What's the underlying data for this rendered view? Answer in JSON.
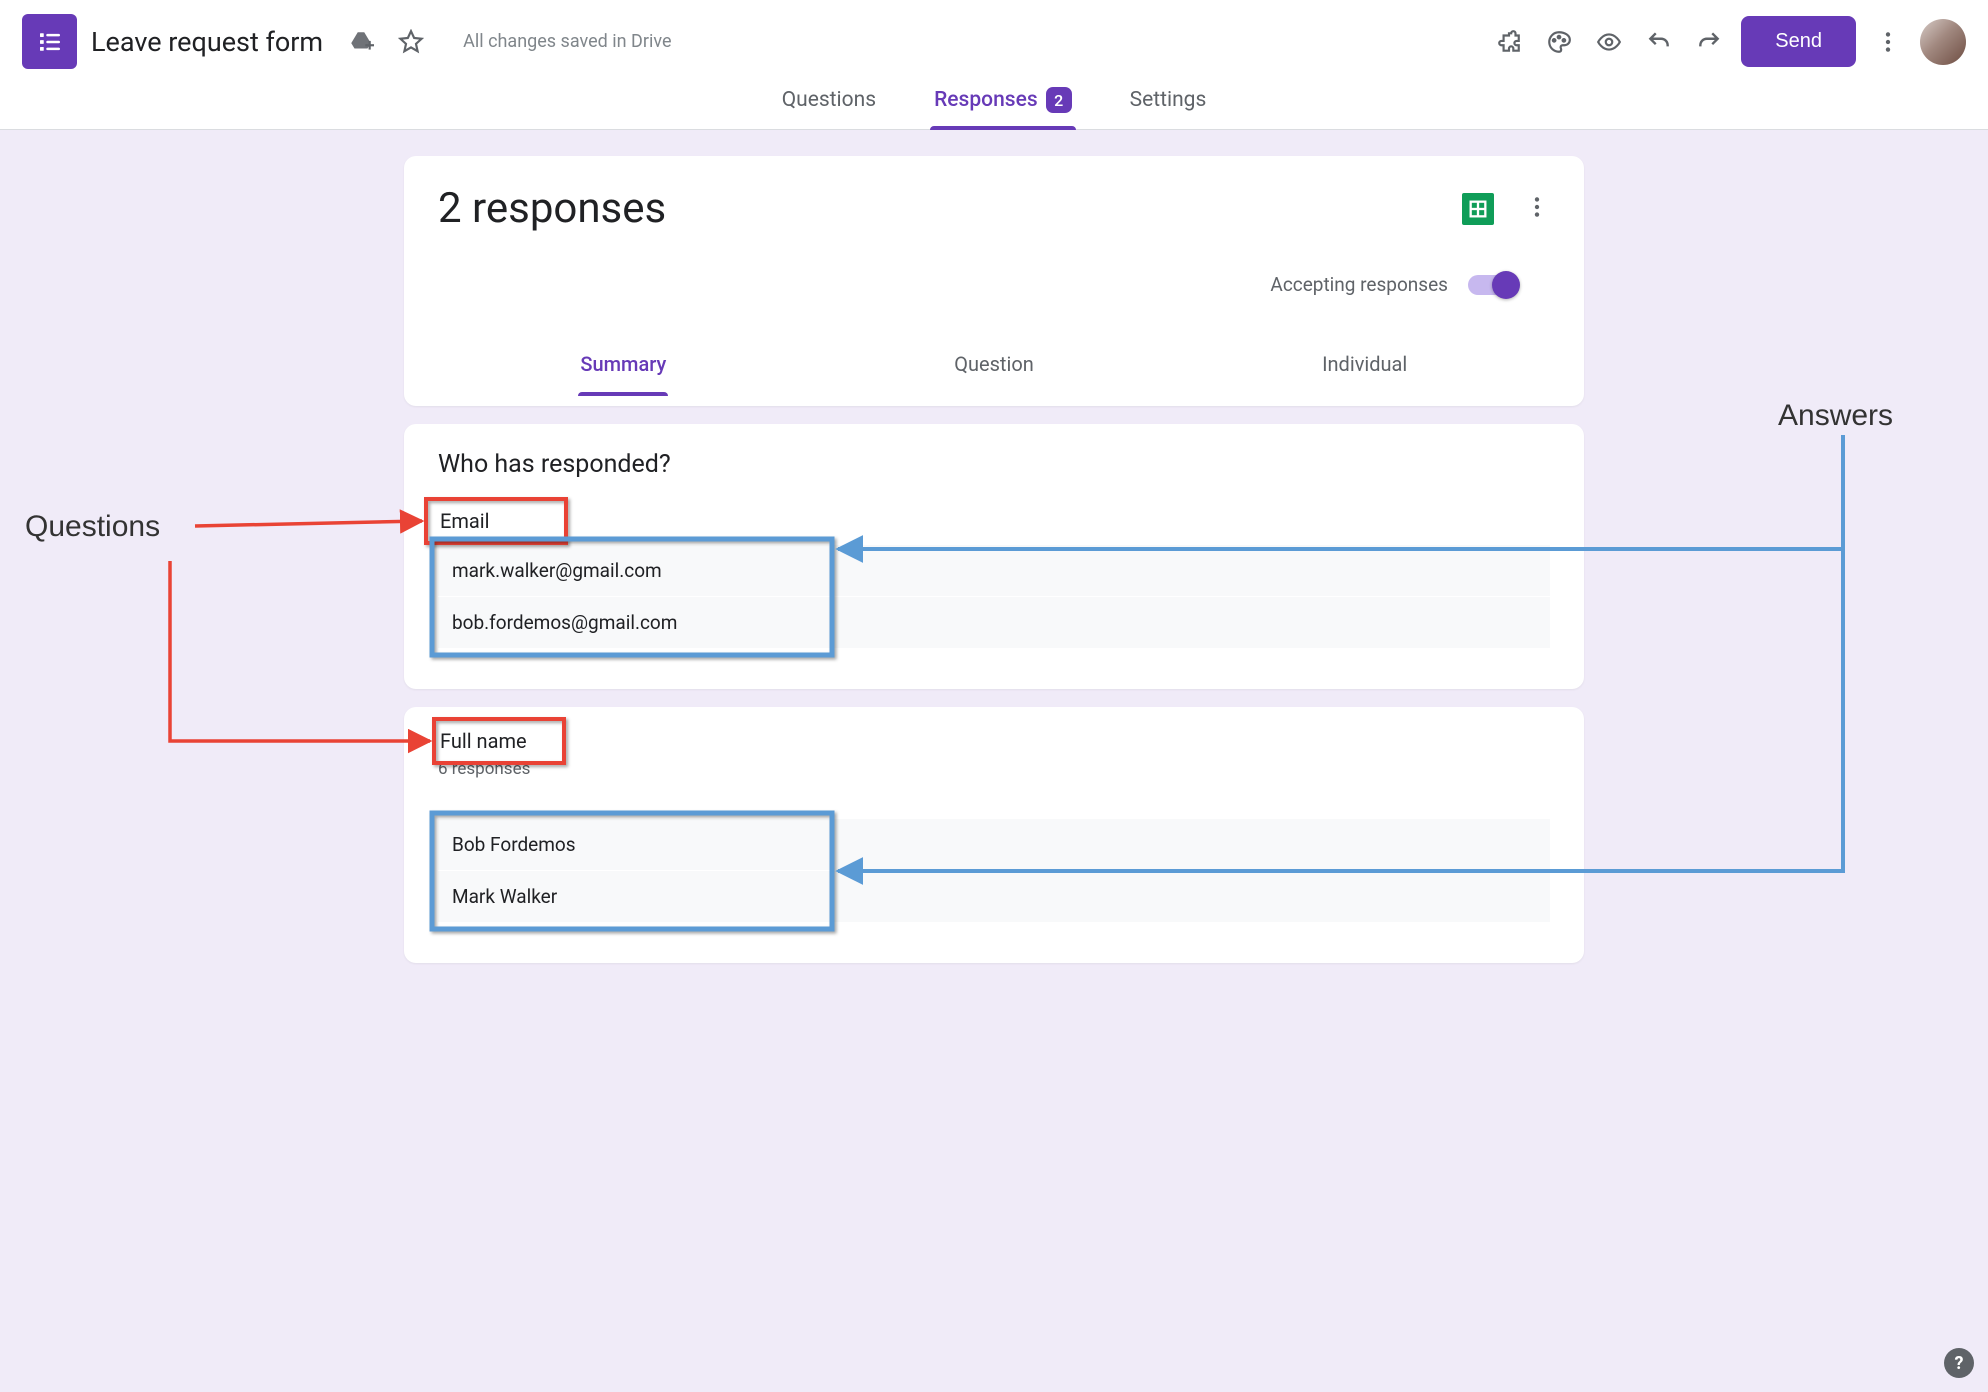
{
  "header": {
    "doc_title": "Leave request form",
    "save_status": "All changes saved in Drive",
    "send_label": "Send"
  },
  "main_tabs": {
    "questions": "Questions",
    "responses": "Responses",
    "responses_count": "2",
    "settings": "Settings"
  },
  "responses_card": {
    "title": "2 responses",
    "accepting_label": "Accepting responses",
    "subtabs": {
      "summary": "Summary",
      "question": "Question",
      "individual": "Individual"
    }
  },
  "who_card": {
    "title": "Who has responded?",
    "question_label": "Email",
    "answers": [
      "mark.walker@gmail.com",
      "bob.fordemos@gmail.com"
    ]
  },
  "fullname_card": {
    "question_label": "Full name",
    "sub": "6 responses",
    "answers": [
      "Bob Fordemos",
      "Mark Walker"
    ]
  },
  "annotations": {
    "left_label": "Questions",
    "right_label": "Answers"
  },
  "icons": {
    "drive": "drive-add-icon",
    "star": "star-icon",
    "addons": "puzzle-icon",
    "theme": "palette-icon",
    "preview": "eye-icon",
    "undo": "undo-icon",
    "redo": "redo-icon",
    "more": "more-vert-icon",
    "sheets": "sheets-icon",
    "help": "?"
  },
  "colors": {
    "accent": "#673ab7",
    "red": "#e94335",
    "blue": "#5b9bd5"
  }
}
